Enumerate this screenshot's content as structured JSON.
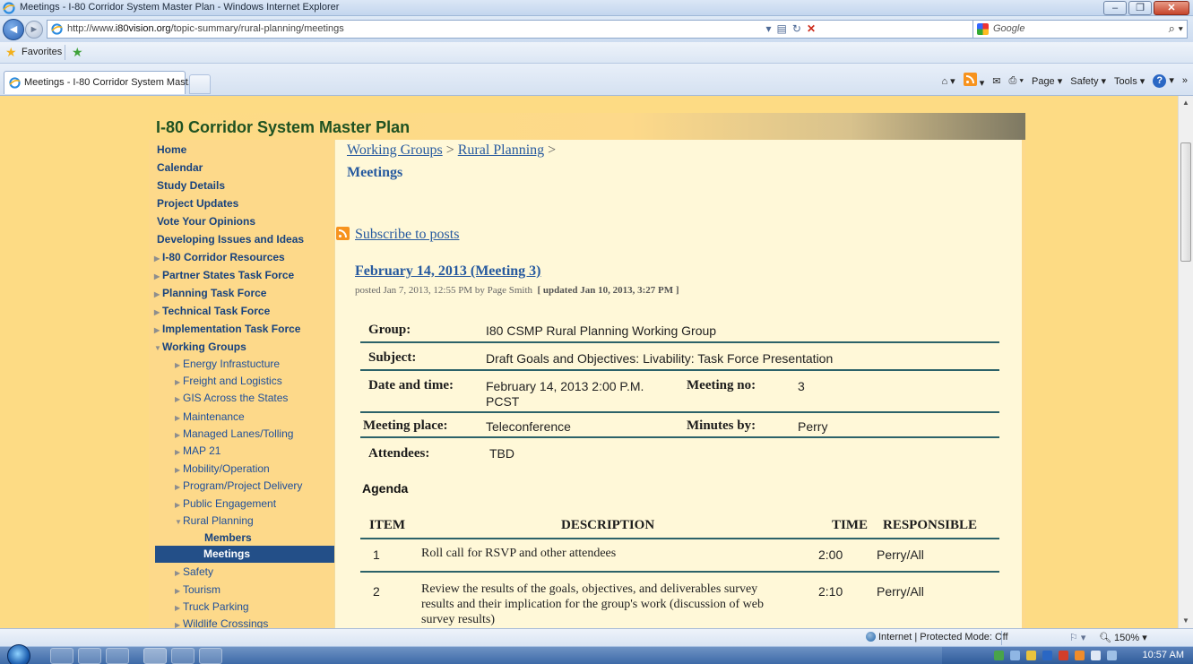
{
  "browser": {
    "window_title": "Meetings - I-80 Corridor System Master Plan - Windows Internet Explorer",
    "url_prefix": "http://www.",
    "url_domain": "i80vision.org",
    "url_path": "/topic-summary/rural-planning/meetings",
    "search_placeholder": "Google",
    "favorites_label": "Favorites",
    "tab_title": "Meetings - I-80 Corridor System Mast...",
    "cmd": {
      "page": "Page ▾",
      "safety": "Safety ▾",
      "tools": "Tools ▾"
    },
    "status_zone": "Internet | Protected Mode: Off",
    "zoom": "150%",
    "clock": "10:57 AM"
  },
  "site": {
    "title": "I-80 Corridor System Master Plan"
  },
  "nav": {
    "top": [
      "Home",
      "Calendar",
      "Study Details",
      "Project Updates",
      "Vote Your Opinions",
      "Developing Issues and Ideas"
    ],
    "sections": [
      "I-80 Corridor Resources",
      "Partner States Task Force",
      "Planning Task Force",
      "Technical Task Force",
      "Implementation Task Force",
      "Working Groups"
    ],
    "groups": [
      "Energy Infrastucture",
      "Freight and Logistics",
      "GIS Across the States",
      "Maintenance",
      "Managed Lanes/Tolling",
      "MAP 21",
      "Mobility/Operation",
      "Program/Project Delivery",
      "Public Engagement",
      "Rural Planning"
    ],
    "rural_children": [
      "Members",
      "Meetings"
    ],
    "groups_after": [
      "Safety",
      "Tourism",
      "Truck Parking",
      "Wildlife Crossings"
    ]
  },
  "content": {
    "breadcrumb": {
      "working_groups": "Working Groups",
      "sep": " > ",
      "rural_planning": "Rural Planning",
      "trail": " >"
    },
    "heading": "Meetings",
    "subscribe": "Subscribe to posts",
    "post": {
      "title": "February 14, 2013 (Meeting 3)",
      "meta": "posted Jan 7, 2013, 12:55 PM by Page Smith",
      "updated": "[ updated Jan 10, 2013, 3:27 PM ]"
    },
    "fields": {
      "group_label": "Group:",
      "group_value": "I80 CSMP Rural Planning Working Group",
      "subject_label": "Subject:",
      "subject_value": "Draft Goals and Objectives: Livability: Task Force Presentation",
      "datetime_label": "Date and time:",
      "datetime_value": "February 14, 2013 2:00 P.M. PCST",
      "meetingno_label": "Meeting no:",
      "meetingno_value": "3",
      "place_label": "Meeting place:",
      "place_value": "Teleconference",
      "minutes_label": "Minutes by:",
      "minutes_value": "Perry",
      "attendees_label": "Attendees:",
      "attendees_value": "TBD"
    },
    "agenda_label": "Agenda",
    "table": {
      "headers": [
        "ITEM",
        "DESCRIPTION",
        "TIME",
        "RESPONSIBLE"
      ],
      "rows": [
        {
          "item": "1",
          "desc": "Roll call for RSVP and other attendees",
          "time": "2:00",
          "resp": "Perry/All"
        },
        {
          "item": "2",
          "desc": "Review the results of the goals, objectives, and deliverables survey results and their implication for the group's work (discussion of web survey results)",
          "time": "2:10",
          "resp": "Perry/All"
        }
      ]
    }
  },
  "colors": {
    "page_bg": "#fddb84",
    "content_bg": "#fff8d8",
    "nav_link": "#17427e",
    "site_title": "#1f5222",
    "selected": "#234f88",
    "rule": "#2c6269"
  }
}
